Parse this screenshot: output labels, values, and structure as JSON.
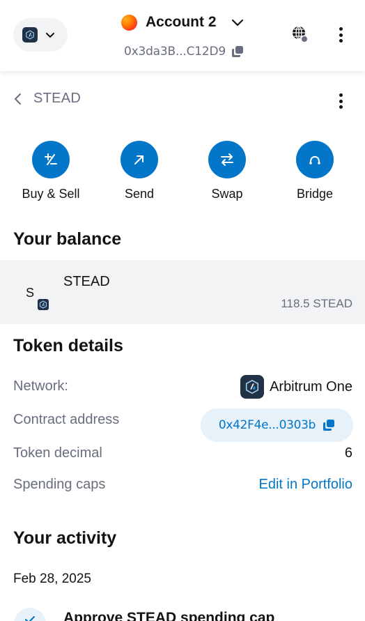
{
  "header": {
    "account_name": "Account 2",
    "address": "0x3da3B...C12D9"
  },
  "token_page": {
    "back_title": "STEAD"
  },
  "actions": [
    {
      "label": "Buy & Sell",
      "icon": "plus-minus-icon"
    },
    {
      "label": "Send",
      "icon": "arrow-up-right-icon"
    },
    {
      "label": "Swap",
      "icon": "swap-arrows-icon"
    },
    {
      "label": "Bridge",
      "icon": "bridge-icon"
    }
  ],
  "balance": {
    "title": "Your balance",
    "token_initial": "S",
    "token_name": "STEAD",
    "amount": "118.5 STEAD"
  },
  "token_details": {
    "title": "Token details",
    "network_label": "Network:",
    "network_value": "Arbitrum One",
    "contract_label": "Contract address",
    "contract_value": "0x42F4e...0303b",
    "decimal_label": "Token decimal",
    "decimal_value": "6",
    "caps_label": "Spending caps",
    "caps_link": "Edit in Portfolio"
  },
  "activity": {
    "title": "Your activity",
    "date": "Feb 28, 2025",
    "item_title": "Approve STEAD spending cap"
  },
  "colors": {
    "accent": "#0376c9",
    "text_muted": "#686e7d",
    "row_bg": "#f2f3f4",
    "arbitrum_bg": "#213147"
  }
}
